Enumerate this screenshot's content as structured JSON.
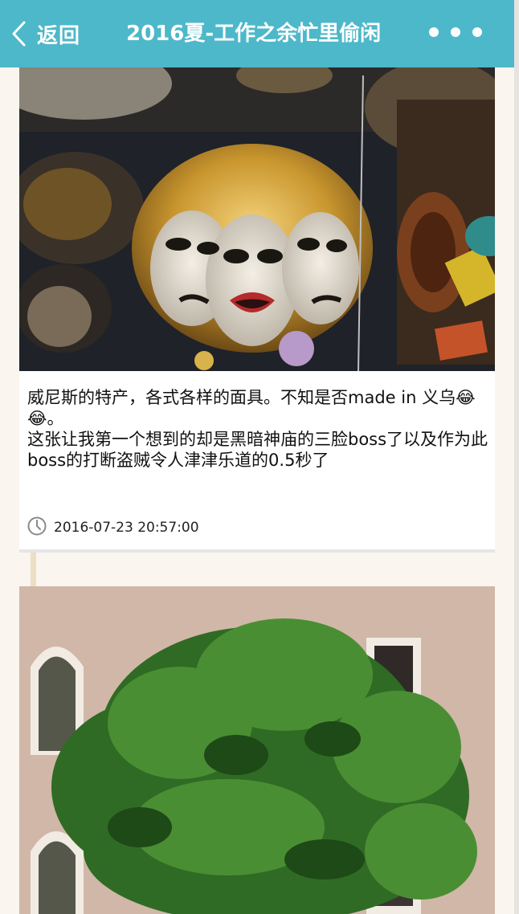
{
  "nav": {
    "back_label": "返回",
    "title": "2016夏-工作之余忙里偷闲"
  },
  "posts": [
    {
      "caption_line1": "威尼斯的特产，各式各样的面具。不知是否made in 义乌😂😂。",
      "caption_line2": "这张让我第一个想到的却是黑暗神庙的三脸boss了以及作为此boss的打断盗贼令人津津乐道的0.5秒了",
      "time": "2016-07-23 20:57:00"
    }
  ],
  "colors": {
    "nav_bg": "#4db8c9",
    "page_bg": "#faf5ef",
    "timeline": "#ebdfc5"
  },
  "icons": {
    "back": "chevron-left-icon",
    "more": "more-dots-icon",
    "clock": "clock-icon"
  }
}
